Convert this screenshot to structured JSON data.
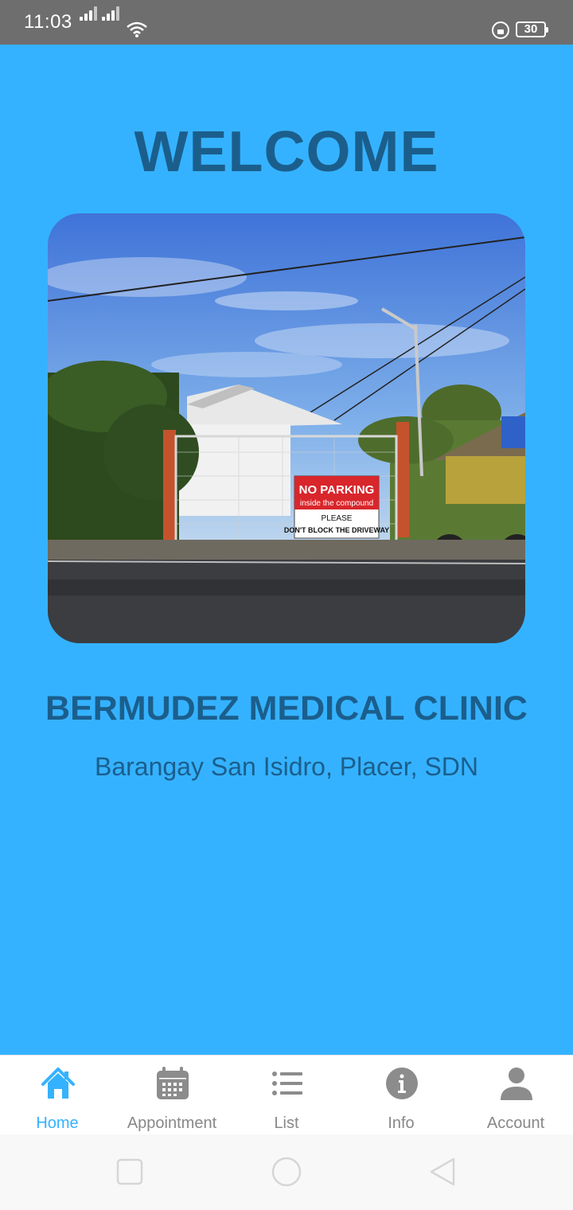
{
  "status_bar": {
    "time": "11:03",
    "battery": "30"
  },
  "main": {
    "welcome": "WELCOME",
    "photo_sign": {
      "line1": "NO PARKING",
      "line2": "inside the compound",
      "line3": "PLEASE",
      "line4": "DON'T BLOCK THE DRIVEWAY"
    },
    "clinic_name": "BERMUDEZ MEDICAL CLINIC",
    "address": "Barangay San Isidro, Placer, SDN"
  },
  "bottom_nav": {
    "items": [
      {
        "label": "Home",
        "icon": "home-icon",
        "active": true
      },
      {
        "label": "Appointment",
        "icon": "calendar-icon",
        "active": false
      },
      {
        "label": "List",
        "icon": "list-icon",
        "active": false
      },
      {
        "label": "Info",
        "icon": "info-icon",
        "active": false
      },
      {
        "label": "Account",
        "icon": "account-icon",
        "active": false
      }
    ]
  },
  "colors": {
    "accent": "#35b2ff",
    "heading": "#1b5e8c",
    "inactive": "#888888"
  }
}
